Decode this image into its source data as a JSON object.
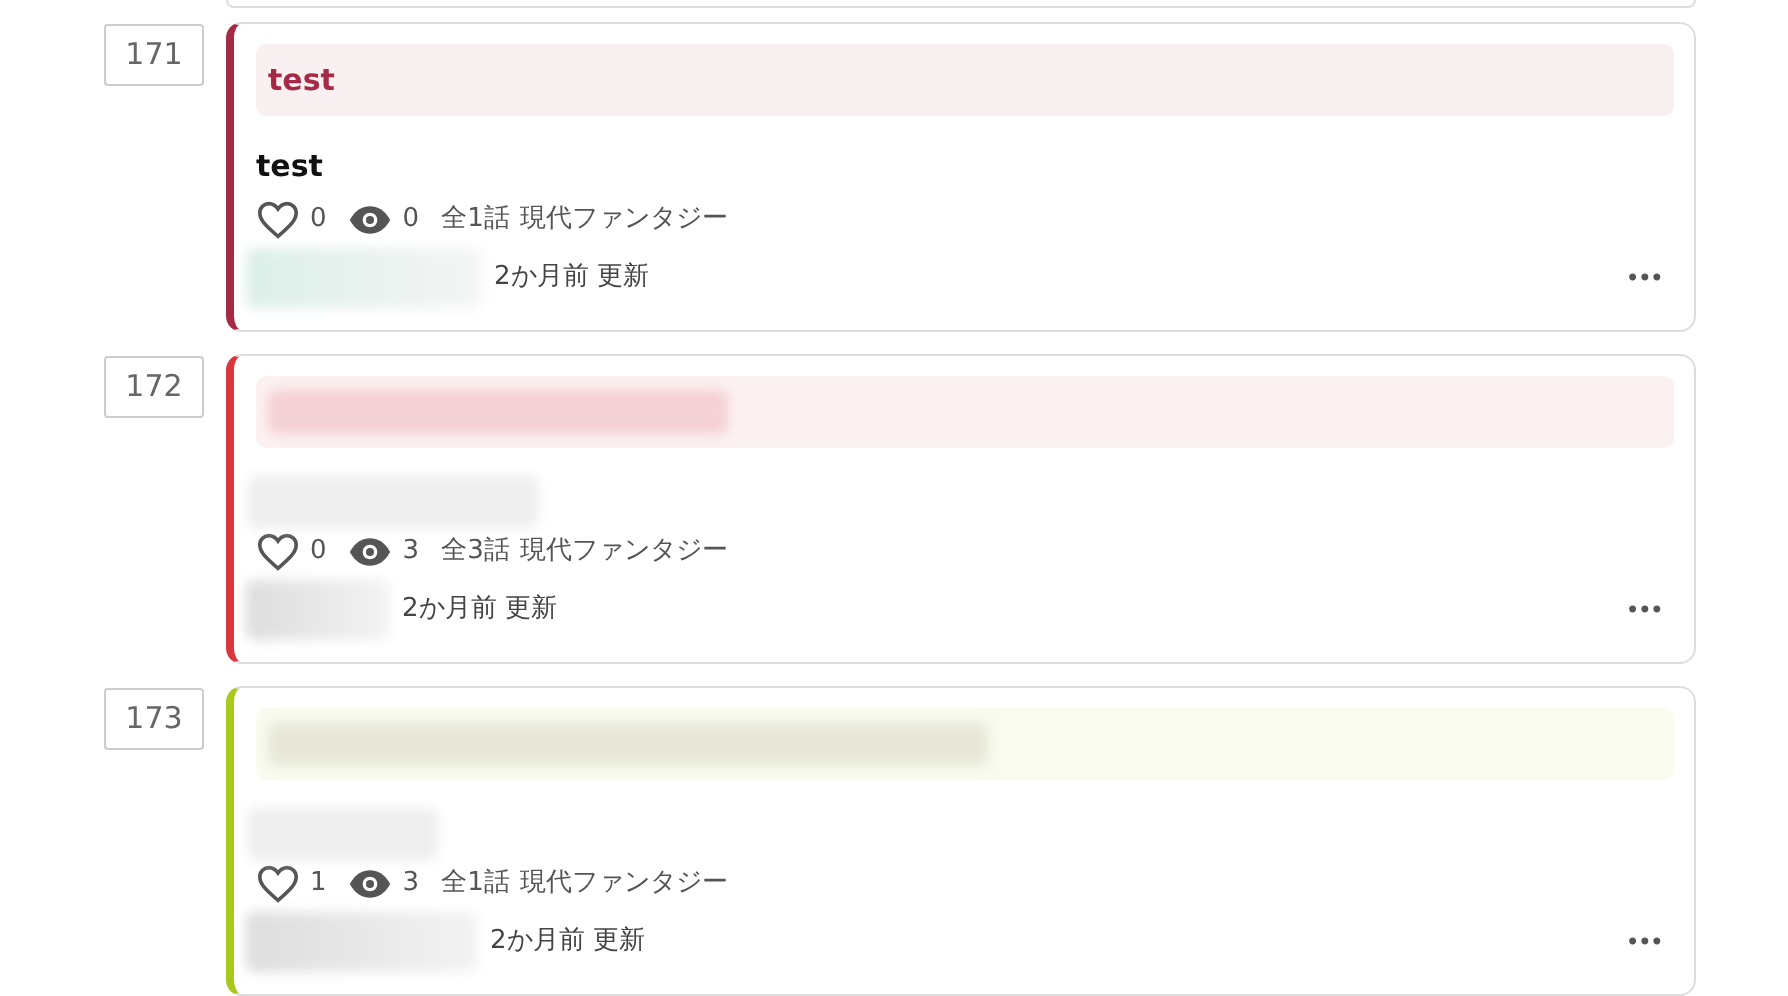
{
  "items": [
    {
      "number": "171",
      "color": "#a52a45",
      "tag_blurred": false,
      "tag": "test",
      "title_blurred": false,
      "title": "test",
      "likes": "0",
      "views": "0",
      "episodes": "全1話",
      "genre": "現代ファンタジー",
      "author_blurred": true,
      "updated": "2か月前 更新",
      "menu": "•••"
    },
    {
      "number": "172",
      "color": "#d9363e",
      "tag_blurred": true,
      "title_blurred": true,
      "likes": "0",
      "views": "3",
      "episodes": "全3話",
      "genre": "現代ファンタジー",
      "author_blurred": true,
      "updated": "2か月前 更新",
      "menu": "•••"
    },
    {
      "number": "173",
      "color": "#a8c81d",
      "tag_blurred": true,
      "title_blurred": true,
      "likes": "1",
      "views": "3",
      "episodes": "全1話",
      "genre": "現代ファンタジー",
      "author_blurred": true,
      "updated": "2か月前 更新",
      "menu": "•••"
    }
  ]
}
